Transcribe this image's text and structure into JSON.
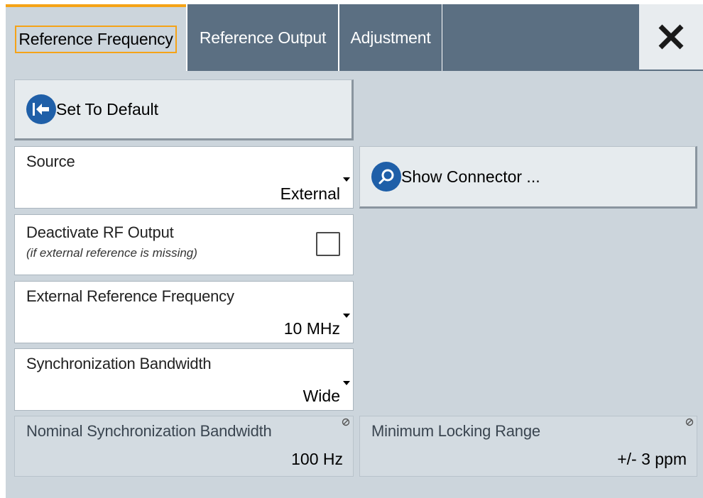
{
  "tabs": [
    {
      "label": "Reference Frequency",
      "active": true
    },
    {
      "label": "Reference Output",
      "active": false
    },
    {
      "label": "Adjustment",
      "active": false
    }
  ],
  "close": {
    "icon": "close-icon"
  },
  "set_default": {
    "label": "Set To Default",
    "icon": "set-default-icon"
  },
  "source": {
    "label": "Source",
    "value": "External"
  },
  "show_connector": {
    "label": "Show Connector ...",
    "icon": "search-icon"
  },
  "deactivate_rf": {
    "label": "Deactivate RF Output",
    "sublabel": "(if external reference is missing)",
    "checked": false
  },
  "ext_ref_freq": {
    "label": "External Reference Frequency",
    "value": "10 MHz"
  },
  "sync_bw": {
    "label": "Synchronization Bandwidth",
    "value": "Wide"
  },
  "nominal_sync_bw": {
    "label": "Nominal Synchronization Bandwidth",
    "value": "100 Hz"
  },
  "min_locking": {
    "label": "Minimum Locking Range",
    "value": "+/- 3 ppm"
  },
  "colors": {
    "accent": "#f5a317",
    "tab_bar": "#5b6f82",
    "panel": "#ccd5dc",
    "icon_blue": "#1f5fa8"
  }
}
